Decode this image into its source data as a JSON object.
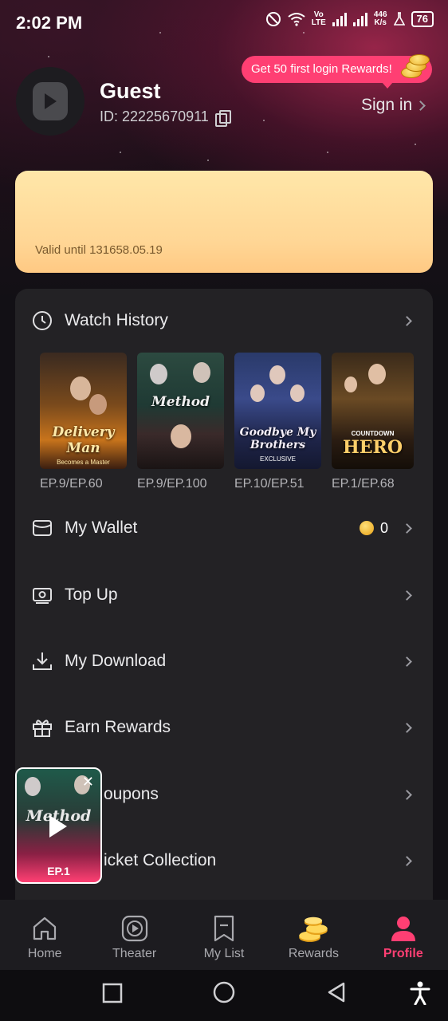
{
  "status_bar": {
    "time": "2:02 PM",
    "network_speed_value": "446",
    "network_speed_unit": "K/s",
    "lte_top": "Vo",
    "lte_bottom": "LTE",
    "battery": "76"
  },
  "profile": {
    "name": "Guest",
    "id_text": "ID: 22225670911",
    "rewards_tip": "Get 50 first login Rewards!",
    "sign_in": "Sign in"
  },
  "vip_card": {
    "valid_text": "Valid until 131658.05.19"
  },
  "watch_history": {
    "title": "Watch History",
    "items": [
      {
        "title": "Delivery Man",
        "subtitle": "Becomes a Master",
        "episode": "EP.9/EP.60"
      },
      {
        "title": "Method",
        "subtitle": "",
        "episode": "EP.9/EP.100"
      },
      {
        "title": "Goodbye My Brothers",
        "subtitle": "EXCLUSIVE",
        "episode": "EP.10/EP.51"
      },
      {
        "title": "HERO",
        "subtitle": "COUNTDOWN",
        "episode": "EP.1/EP.68"
      }
    ]
  },
  "menu": {
    "wallet": {
      "label": "My Wallet",
      "balance": "0"
    },
    "top_up": {
      "label": "Top Up"
    },
    "download": {
      "label": "My Download"
    },
    "earn_rewards": {
      "label": "Earn Rewards"
    },
    "coupons": {
      "label": "oupons"
    },
    "ticket_collection": {
      "label": "icket Collection"
    }
  },
  "mini_player": {
    "title": "Method",
    "episode": "EP.1"
  },
  "bottom_nav": {
    "home": "Home",
    "theater": "Theater",
    "my_list": "My List",
    "rewards": "Rewards",
    "profile": "Profile"
  },
  "colors": {
    "accent": "#ff3f73",
    "panel": "#232225",
    "vip_gold": "#ffd695"
  }
}
